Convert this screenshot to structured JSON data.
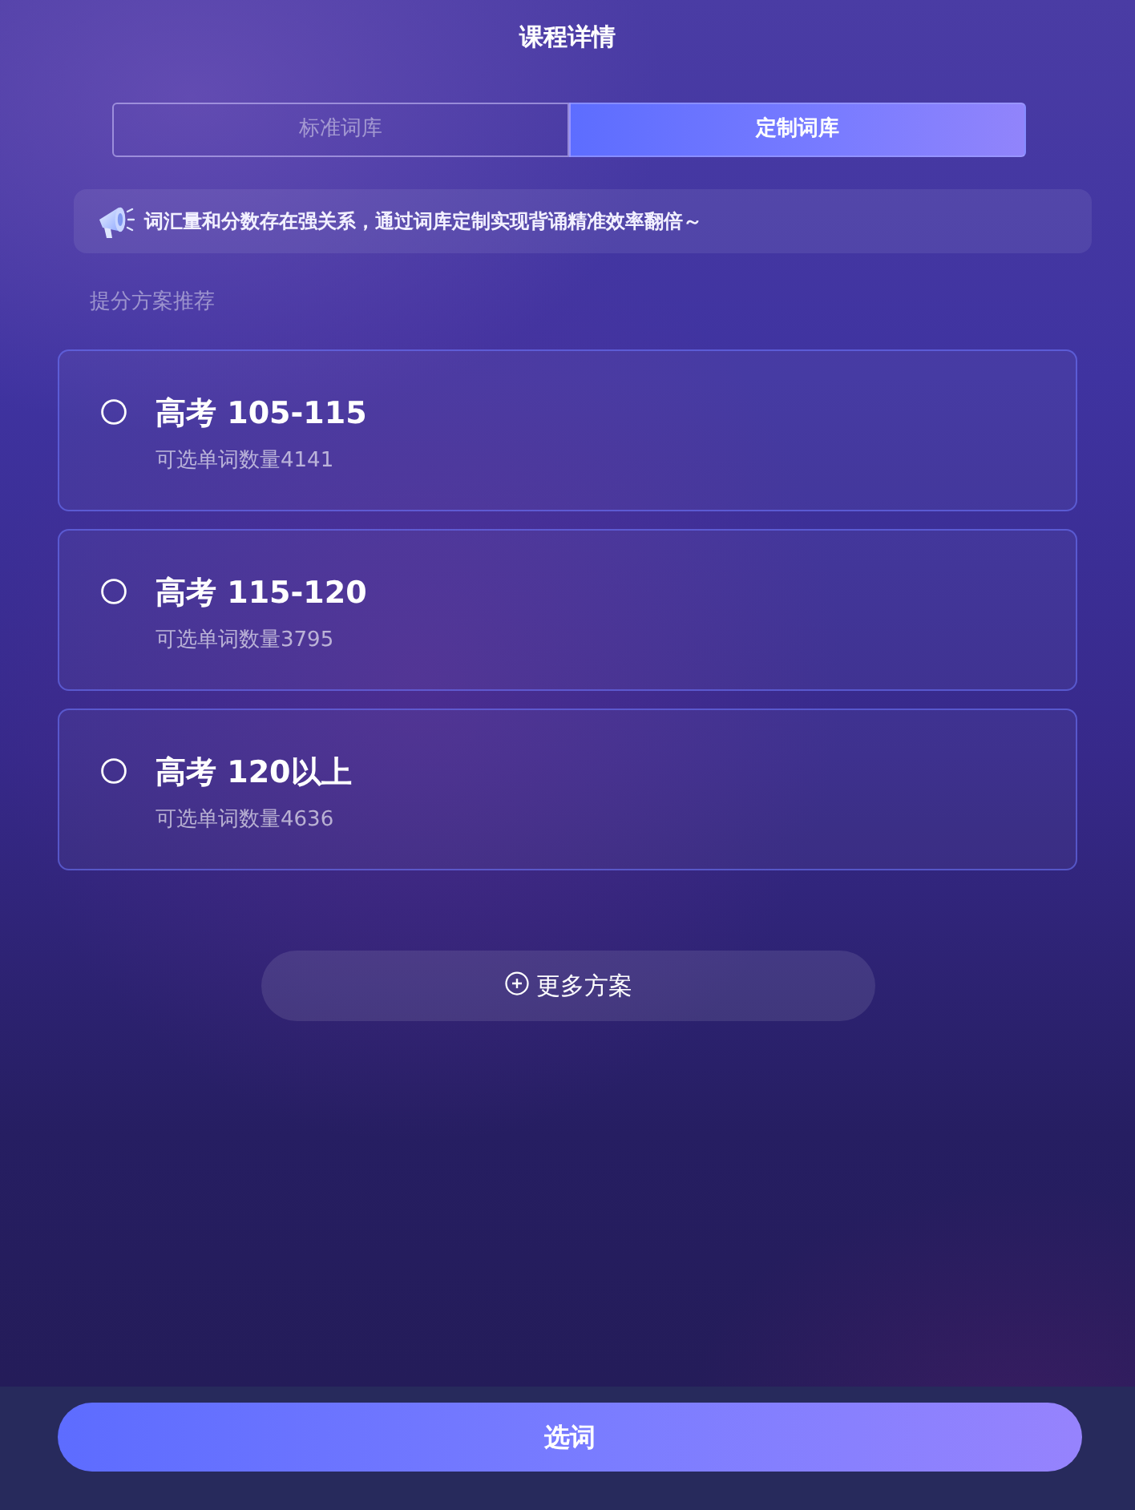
{
  "header": {
    "title": "课程详情"
  },
  "tabs": [
    {
      "label": "标准词库",
      "selected": false
    },
    {
      "label": "定制词库",
      "selected": true
    }
  ],
  "notice": {
    "text": "词汇量和分数存在强关系，通过词库定制实现背诵精准效率翻倍～"
  },
  "section_title": "提分方案推荐",
  "plans": [
    {
      "title": "高考 105-115",
      "subtitle": "可选单词数量4141",
      "selected": false
    },
    {
      "title": "高考 115-120",
      "subtitle": "可选单词数量3795",
      "selected": false
    },
    {
      "title": "高考 120以上",
      "subtitle": "可选单词数量4636",
      "selected": false
    }
  ],
  "more_button": {
    "label": "更多方案"
  },
  "primary_button": {
    "label": "选词"
  }
}
